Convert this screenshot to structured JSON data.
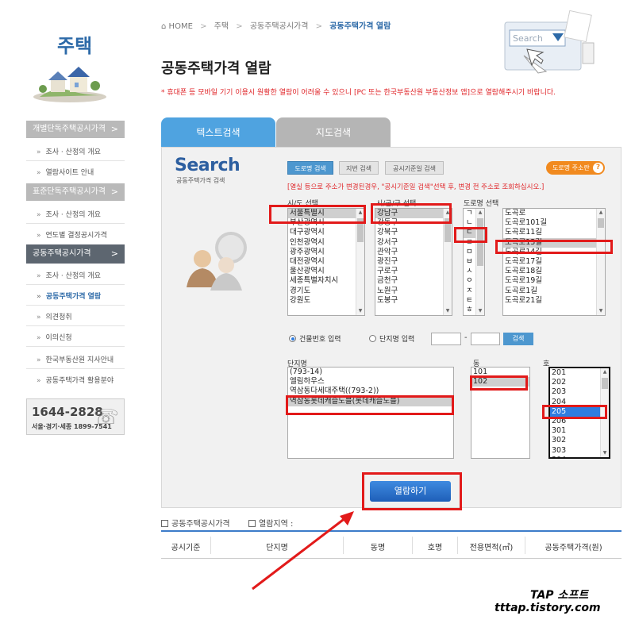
{
  "sidebar": {
    "title": "주택",
    "phone_main": "1644-2828",
    "phone_sub": "서울·경기·세종 1899-7541",
    "menus": [
      {
        "label": "개별단독주택공시가격"
      },
      {
        "label": "조사 · 산정의 개요"
      },
      {
        "label": "열람사이트 안내"
      },
      {
        "label": "표준단독주택공시가격"
      },
      {
        "label": "조사 · 산정의 개요"
      },
      {
        "label": "연도별 결정공시가격"
      },
      {
        "label": "공동주택공시가격"
      },
      {
        "label": "조사 · 산정의 개요"
      },
      {
        "label": "공동주택가격 열람"
      },
      {
        "label": "의견청취"
      },
      {
        "label": "이의신청"
      },
      {
        "label": "한국부동산원 지사안내"
      },
      {
        "label": "공동주택가격 활용분야"
      }
    ]
  },
  "breadcrumb": {
    "home": "HOME",
    "l1": "주택",
    "l2": "공동주택공시가격",
    "current": "공동주택가격 열람"
  },
  "page_title": "공동주택가격 열람",
  "notice": "* 휴대폰 등 모바일 기기 이용시 원활한 열람이 어려울 수 있으니 [PC 또는 한국부동산원 부동산정보 앱]으로 열람해주시기 바랍니다.",
  "tabs": {
    "text_search": "텍스트검색",
    "map_search": "지도검색"
  },
  "search": {
    "logo": "Search",
    "sub": "공동주택가격 검색",
    "btn_road": "도로명 검색",
    "btn_lot": "지번 검색",
    "btn_date": "공시기준일 검색",
    "btn_addr": "도로명 주소란",
    "warning": "[열실 등으로 주소가 변경된경우, \"공시기준일 검색\"선택 후, 변경 전 주소로 조회하십시오.]",
    "label_sido": "시/도 선택",
    "label_sigungu": "시/군/구 선택",
    "label_road": "도로명 선택",
    "sido": [
      "서울특별시",
      "부산광역시",
      "대구광역시",
      "인천광역시",
      "광주광역시",
      "대전광역시",
      "울산광역시",
      "세종특별자치시",
      "경기도",
      "강원도"
    ],
    "sigungu": [
      "강남구",
      "강동구",
      "강북구",
      "강서구",
      "관악구",
      "광진구",
      "구로구",
      "금천구",
      "노원구",
      "도봉구"
    ],
    "consonants": [
      "ㄱ",
      "ㄴ",
      "ㄷ",
      "ㄹ",
      "ㅁ",
      "ㅂ",
      "ㅅ",
      "ㅇ",
      "ㅈ",
      "ㅌ",
      "ㅎ"
    ],
    "roads": [
      "도곡로",
      "도곡로101길",
      "도곡로11길",
      "도곡로13길",
      "도곡로14길",
      "도곡로17길",
      "도곡로18길",
      "도곡로19길",
      "도곡로1길",
      "도곡로21길"
    ],
    "radio_building": "건물번호 입력",
    "radio_complex": "단지명 입력",
    "dash": "-",
    "small_search": "검색",
    "label_complex": "단지명",
    "label_dong": "동",
    "label_ho": "호",
    "complexes": [
      "(793-14)",
      "엘림하우스",
      "역삼동다세대주택((793-2))",
      "역삼동롯데캐슬노블(롯데캐슬노블)"
    ],
    "dongs": [
      "101",
      "102"
    ],
    "hos": [
      "201",
      "202",
      "203",
      "204",
      "205",
      "206",
      "301",
      "302",
      "303",
      "304"
    ],
    "view_btn": "열람하기"
  },
  "results": {
    "title": "공동주택공시가격",
    "region_label": "열람지역 :",
    "columns": [
      "공시기준",
      "단지명",
      "동명",
      "호명",
      "전용면적(㎡)",
      "공동주택가격(원)"
    ]
  },
  "watermark": {
    "line1": "TAP 소프트",
    "line2": "tttap.tistory.com"
  },
  "colors": {
    "accent_blue": "#4fa3e0",
    "highlight_red": "#e21a1a",
    "notice_red": "#e0262a",
    "orange": "#f18a1f"
  }
}
